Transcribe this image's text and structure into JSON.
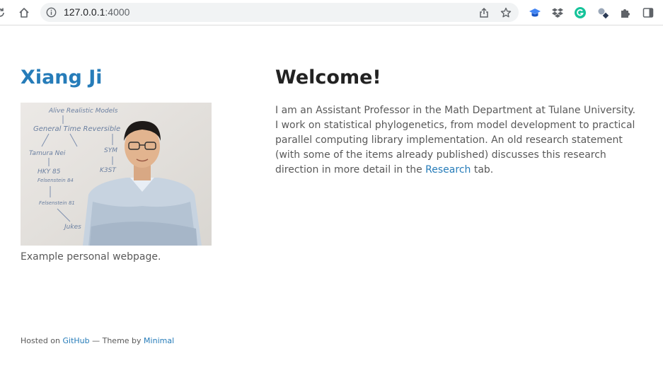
{
  "browser": {
    "url_host": "127.0.0.1",
    "url_port": ":4000"
  },
  "sidebar": {
    "site_title": "Xiang Ji",
    "photo_caption": "Example personal webpage.",
    "whiteboard_text": {
      "line1": "Alive Realistic Models",
      "line2": "General Time Reversible",
      "line3": "Tamura Nei",
      "line4": "HKY 85",
      "line5": "Felsenstein 84",
      "line6": "SYM",
      "line7": "K3ST",
      "line8": "Felsenstein 81",
      "line9": "Jukes"
    }
  },
  "main": {
    "heading": "Welcome!",
    "intro_text_before_link": "I am an Assistant Professor in the Math Department at Tulane University. I work on statistical phylogenetics, from model development to practical parallel computing library implementation. An old research statement (with some of the items already published) discusses this research direction in more detail in the ",
    "intro_link": "Research",
    "intro_text_after_link": " tab."
  },
  "footer": {
    "hosted_on": "Hosted on",
    "github_link": "GitHub",
    "theme_by": " — Theme by ",
    "theme_link": "Minimal"
  },
  "colors": {
    "accent": "#267CB9",
    "heading": "#222222",
    "body_text": "#595959"
  }
}
